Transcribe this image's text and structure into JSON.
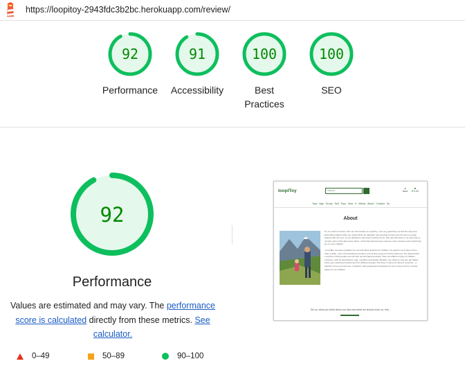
{
  "url": "https://loopitoy-2943fdc3b2bc.herokuapp.com/review/",
  "colors": {
    "pass": "#0dbf5d",
    "pass_text": "#008800",
    "pass_fill": "#e5f8ec",
    "average": "#f7a31c",
    "fail": "#e5311c",
    "link": "#1a5bc4"
  },
  "icons": {
    "logo": "lighthouse-logo"
  },
  "categories": [
    {
      "name": "Performance",
      "score": "92",
      "score_value": 92
    },
    {
      "name": "Accessibility",
      "score": "91",
      "score_value": 91
    },
    {
      "name": "Best Practices",
      "score": "100",
      "score_value": 100
    },
    {
      "name": "SEO",
      "score": "100",
      "score_value": 100
    }
  ],
  "performance": {
    "score": "92",
    "score_value": 92,
    "title": "Performance",
    "note_prefix": "Values are estimated and may vary. The ",
    "note_link1": "performance score is calculated",
    "note_middle": " directly from these metrics. ",
    "note_link2": "See calculator."
  },
  "legend": [
    {
      "icon": "triangle",
      "range": "0–49"
    },
    {
      "icon": "square",
      "range": "50–89"
    },
    {
      "icon": "circle",
      "range": "90–100"
    }
  ],
  "thumbnail": {
    "brand": "loopIToy",
    "search_placeholder": "Search",
    "account_label": "Acct",
    "bag_label": "$ 0.00",
    "nav_items": "Toys Age Group Sell Toys How It Works About Contact Us",
    "heading": "About",
    "paragraph1": "Hi, me name is Sonia, and I am the founder of LoopIToy. I am very glad that you find the way here. Everything started when we noticed that our daughter was growing so fast and she was no longer playing with her toys, so we decided to give them another home. We saw that there is no easy way to do that, and so this idea came about. I think that preloved toys deserve more chances and could bring joy to more children.",
    "paragraph2": "In IceHila, we have a platform for second-hand products for children. So great to let it have a here. After a while, I got a bit frustrated and spent a lot of time trying to find the right toys. The idea behind LoopIToy is that people can sell their second-hand products: there are different types of children products, such as descriptions, age, condition and quality. Besides, the delivery cost can get higher when your selected products are from different people. And there it came the idea of LoopIToy - a platform to buy and sell toys. A platform with guaranteed checkouts for less money and for a better planet for our children.",
    "footer": "Tell us, what you think about our idea and what we should work on, this..."
  }
}
